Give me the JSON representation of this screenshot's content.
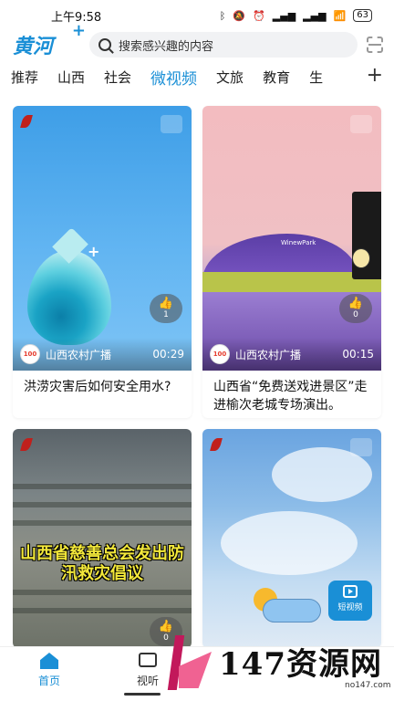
{
  "status_bar": {
    "time": "上午9:58",
    "icons": [
      "bluetooth-icon",
      "mute-icon",
      "alarm-icon",
      "signal-icon",
      "signal-icon",
      "wifi-icon"
    ],
    "battery": "63"
  },
  "header": {
    "logo": "黄河",
    "logo_plus": "+",
    "search_placeholder": "搜索感兴趣的内容"
  },
  "tabs": [
    {
      "label": "推荐",
      "active": false
    },
    {
      "label": "山西",
      "active": false
    },
    {
      "label": "社会",
      "active": false
    },
    {
      "label": "微视频",
      "active": true
    },
    {
      "label": "文旅",
      "active": false
    },
    {
      "label": "教育",
      "active": false
    },
    {
      "label": "生",
      "active": false
    }
  ],
  "tab_add": "+",
  "cards": [
    {
      "channel": "山西农村广播",
      "duration": "00:29",
      "likes": "1",
      "title": "洪涝灾害后如何安全用水?",
      "avatar": "山西100"
    },
    {
      "channel": "山西农村广播",
      "duration": "00:15",
      "likes": "0",
      "title": "山西省“免费送戏进景区”走进榆次老城专场演出。",
      "avatar": "山西100",
      "hill_text": "WinewPark"
    },
    {
      "likes": "0",
      "overlay_title": "山西省慈善总会发出防汛救灾倡议"
    },
    {
      "short_video_label": "短视频"
    }
  ],
  "bottom_nav": [
    {
      "label": "首页",
      "active": true
    },
    {
      "label": "视听",
      "active": false
    }
  ],
  "watermark": {
    "text": "147资源网",
    "url": "no147.com"
  },
  "colors": {
    "accent": "#1a8fd6",
    "watermark_pink": "#f06292"
  }
}
